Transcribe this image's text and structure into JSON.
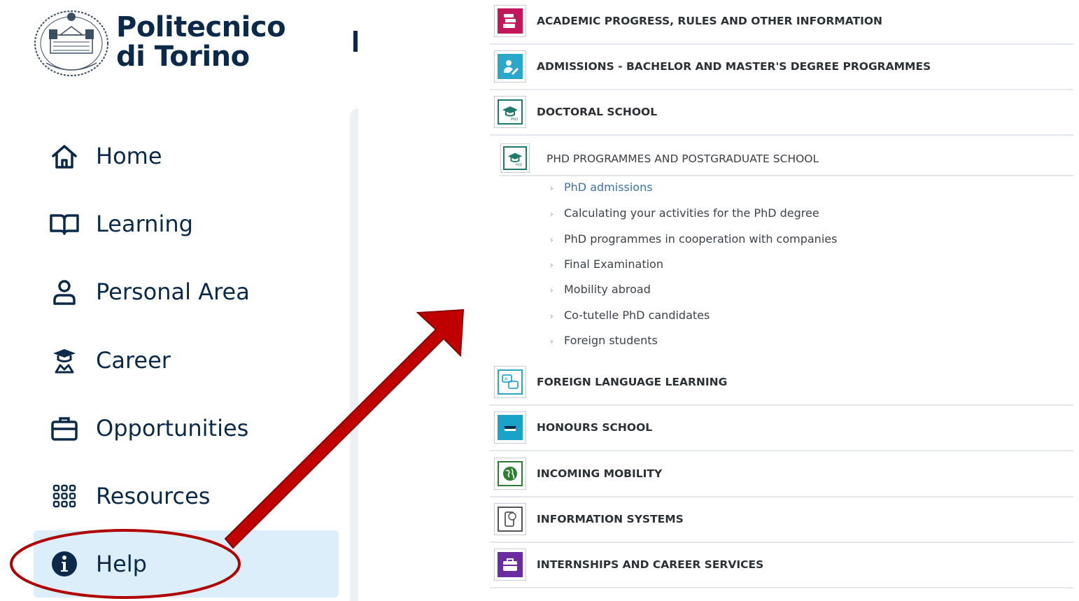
{
  "sidebar": {
    "logo": {
      "line1": "Politecnico",
      "line2": "di Torino"
    },
    "nav": [
      {
        "label": "Home",
        "icon": "home-icon"
      },
      {
        "label": "Learning",
        "icon": "book-icon"
      },
      {
        "label": "Personal Area",
        "icon": "person-icon"
      },
      {
        "label": "Career",
        "icon": "graduate-icon"
      },
      {
        "label": "Opportunities",
        "icon": "briefcase-icon"
      },
      {
        "label": "Resources",
        "icon": "grid-icon"
      },
      {
        "label": "Help",
        "icon": "info-icon",
        "active": true
      }
    ]
  },
  "content": {
    "sections": [
      {
        "label": "ACADEMIC PROGRESS, RULES AND OTHER INFORMATION",
        "icon": "books-icon",
        "color": "#c2185b"
      },
      {
        "label": "ADMISSIONS - BACHELOR AND MASTER'S DEGREE PROGRAMMES",
        "icon": "admissions-icon",
        "color": "#2aa7c9"
      },
      {
        "label": "DOCTORAL SCHOOL",
        "icon": "phd-cap-icon",
        "color": "#1f7a6b"
      },
      {
        "label": "FOREIGN LANGUAGE LEARNING",
        "icon": "language-icon",
        "color": "#2aa7c9"
      },
      {
        "label": "HONOURS SCHOOL",
        "icon": "honours-icon",
        "color": "#1aa3c9"
      },
      {
        "label": "INCOMING MOBILITY",
        "icon": "globe-icon",
        "color": "#2e7d32"
      },
      {
        "label": "INFORMATION SYSTEMS",
        "icon": "info-systems-icon",
        "color": "#555555"
      },
      {
        "label": "INTERNSHIPS AND CAREER SERVICES",
        "icon": "suitcase-icon",
        "color": "#6a2ca0"
      }
    ],
    "subsection": {
      "label": "PHD PROGRAMMES AND POSTGRADUATE SCHOOL",
      "icon": "phd-cap-icon",
      "links": [
        "PhD admissions",
        "Calculating your activities for the PhD degree",
        "PhD programmes in cooperation with companies",
        "Final Examination",
        "Mobility abroad",
        "Co-tutelle PhD candidates",
        "Foreign students"
      ]
    }
  },
  "annotation": {
    "color": "#b00000"
  }
}
